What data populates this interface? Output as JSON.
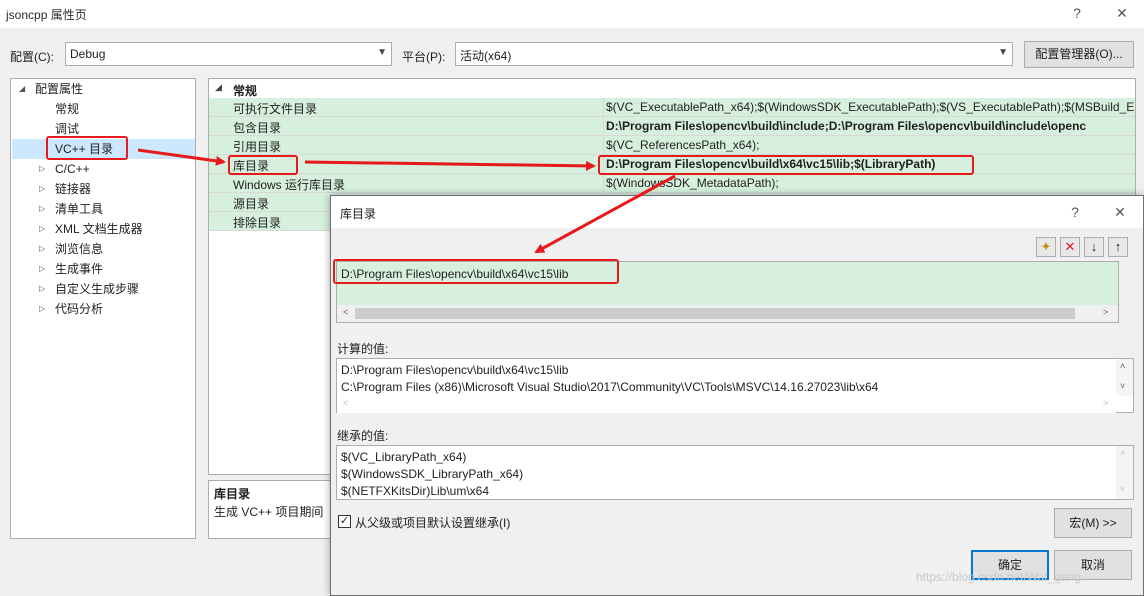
{
  "window": {
    "title": "jsoncpp 属性页",
    "help_glyph": "?",
    "close_glyph": "✕"
  },
  "toolbar": {
    "config_label": "配置(C):",
    "config_value": "Debug",
    "platform_label": "平台(P):",
    "platform_value": "活动(x64)",
    "manager_button": "配置管理器(O)..."
  },
  "tree": {
    "root": "配置属性",
    "items": [
      {
        "label": "常规"
      },
      {
        "label": "调试"
      },
      {
        "label": "VC++ 目录",
        "selected": true
      },
      {
        "label": "C/C++"
      },
      {
        "label": "链接器"
      },
      {
        "label": "清单工具"
      },
      {
        "label": "XML 文档生成器"
      },
      {
        "label": "浏览信息"
      },
      {
        "label": "生成事件"
      },
      {
        "label": "自定义生成步骤"
      },
      {
        "label": "代码分析"
      }
    ]
  },
  "grid": {
    "category": "常规",
    "rows": [
      {
        "key": "可执行文件目录",
        "value": "$(VC_ExecutablePath_x64);$(WindowsSDK_ExecutablePath);$(VS_ExecutablePath);$(MSBuild_E"
      },
      {
        "key": "包含目录",
        "value": "D:\\Program Files\\opencv\\build\\include;D:\\Program Files\\opencv\\build\\include\\openc",
        "bold": true
      },
      {
        "key": "引用目录",
        "value": "$(VC_ReferencesPath_x64);"
      },
      {
        "key": "库目录",
        "value": "D:\\Program Files\\opencv\\build\\x64\\vc15\\lib;$(LibraryPath)",
        "bold": true
      },
      {
        "key": "Windows 运行库目录",
        "value": "$(WindowsSDK_MetadataPath);"
      },
      {
        "key": "源目录",
        "value": ""
      },
      {
        "key": "排除目录",
        "value": ""
      }
    ]
  },
  "description": {
    "title": "库目录",
    "body": "生成 VC++ 项目期间"
  },
  "dialog": {
    "title": "库目录",
    "help_glyph": "?",
    "close_glyph": "✕",
    "tools": {
      "new": "✦",
      "delete": "✕",
      "down": "↓",
      "up": "↑"
    },
    "entries": [
      "D:\\Program Files\\opencv\\build\\x64\\vc15\\lib"
    ],
    "evaluated_label": "计算的值:",
    "evaluated": [
      "D:\\Program Files\\opencv\\build\\x64\\vc15\\lib",
      "C:\\Program Files (x86)\\Microsoft Visual Studio\\2017\\Community\\VC\\Tools\\MSVC\\14.16.27023\\lib\\x64"
    ],
    "inherited_label": "继承的值:",
    "inherited": [
      "$(VC_LibraryPath_x64)",
      "$(WindowsSDK_LibraryPath_x64)",
      "$(NETFXKitsDir)Lib\\um\\x64"
    ],
    "inherit_checkbox": "从父级或项目默认设置继承(I)",
    "inherit_checked": true,
    "macros_button": "宏(M) >>",
    "ok_button": "确定",
    "cancel_button": "取消"
  },
  "watermark": "https://blog.csdn.net/Wat_gang",
  "colors": {
    "annotation_red": "#e8191b",
    "edited_row_green": "#d7f0dd",
    "selection_blue": "#cce8ff"
  }
}
